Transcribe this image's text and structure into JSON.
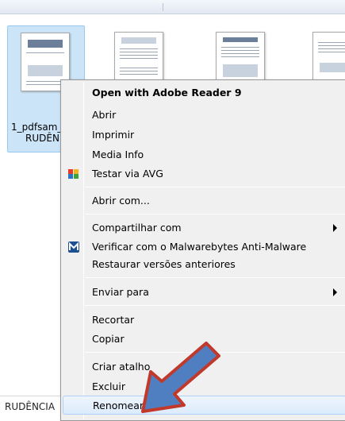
{
  "explorer": {
    "selected_file_name_line1": "1_pdfsam_",
    "selected_file_name_line2": "RUDÊN",
    "bottom_text": "RUDÊNCIA"
  },
  "context_menu": {
    "items": [
      {
        "label": "Open with Adobe Reader 9",
        "bold": true
      },
      {
        "label": "Abrir"
      },
      {
        "label": "Imprimir"
      },
      {
        "label": "Media Info"
      },
      {
        "label": "Testar via  AVG",
        "icon": "avg-icon"
      },
      {
        "label": "Abrir com..."
      },
      {
        "label": "Compartilhar com",
        "submenu": true
      },
      {
        "label": "Verificar com o Malwarebytes Anti-Malware",
        "icon": "malwarebytes-icon"
      },
      {
        "label": "Restaurar versões anteriores"
      },
      {
        "label": "Enviar para",
        "submenu": true
      },
      {
        "label": "Recortar"
      },
      {
        "label": "Copiar"
      },
      {
        "label": "Criar atalho"
      },
      {
        "label": "Excluir"
      },
      {
        "label": "Renomear",
        "highlighted": true
      }
    ]
  },
  "colors": {
    "selection": "#cce4f7",
    "menu_bg": "#f0f0f0",
    "arrow_fill": "#4f7fc0",
    "arrow_stroke": "#c0392b"
  }
}
